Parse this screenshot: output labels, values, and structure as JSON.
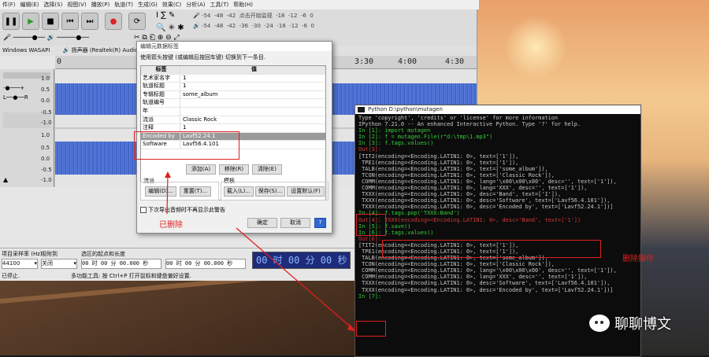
{
  "audacity": {
    "menu": [
      "件(F)",
      "编辑(E)",
      "选择(S)",
      "视图(V)",
      "播放(P)",
      "轨道(T)",
      "生成(G)",
      "效果(C)",
      "分析(A)",
      "工具(T)",
      "帮助(H)"
    ],
    "meter_hint": "点击开始监视",
    "meter_ticks_top": [
      "-54",
      "-48",
      "-42",
      "-18",
      "-12",
      "-6",
      "0"
    ],
    "meter_ticks_bottom": [
      "-54",
      "-48",
      "-42",
      "-36",
      "-30",
      "-24",
      "-18",
      "-12",
      "-6",
      "0"
    ],
    "host": "Windows WASAPI",
    "output_device": "扬声器 (Realtek(R) Audio) (loopb",
    "ruler_ticks": [
      "0",
      "3:30",
      "4:00",
      "4:30"
    ],
    "axis_labels": [
      "1.0",
      "0.5",
      "0.0",
      "-0.5",
      "-1.0",
      "1.0",
      "0.5",
      "0.0",
      "-0.5",
      "-1.0"
    ],
    "project_rate_label": "项目采样率 (Hz)",
    "snap_label": "吸附到",
    "selection_label": "选区的起点和长度",
    "project_rate": "44100",
    "snap_value": "关闭",
    "sel_start": "00 时 00 分 00.000 秒",
    "sel_length": "00 时 00 分 00.000 秒",
    "time_display": "00 时 00 分 00 秒",
    "status_left": "已停止.",
    "status_right": "多功能工具: 按 Ctrl+P 打开鼠标和键盘偏好设置."
  },
  "dialog": {
    "title": "编辑元数据标签",
    "description": "使用箭头按键 (或编辑后按回车键) 切换到下一条目.",
    "col_tag": "标签",
    "col_value": "值",
    "rows": [
      {
        "tag": "艺术家名字",
        "value": "1"
      },
      {
        "tag": "轨道标题",
        "value": "1"
      },
      {
        "tag": "专辑标题",
        "value": "some_album"
      },
      {
        "tag": "轨道编号",
        "value": ""
      },
      {
        "tag": "年",
        "value": ""
      },
      {
        "tag": "流派",
        "value": "Classic Rock"
      },
      {
        "tag": "注释",
        "value": "1"
      },
      {
        "tag": "Encoded by",
        "value": "Lavf52.24.1"
      },
      {
        "tag": "Software",
        "value": "Lavf56.4.101"
      }
    ],
    "add": "添加(A)",
    "remove": "移除(R)",
    "clear": "清除(E)",
    "genre_group": "流派",
    "edit": "编辑(D)...",
    "reset": "重置(T)...",
    "template_group": "模板",
    "load": "载入(L)...",
    "save": "保存(S)...",
    "set_default": "设置默认(F)",
    "dont_show": "下次导出音频时不再显示此警告",
    "ok": "确定",
    "cancel": "取消",
    "help": "?"
  },
  "annotations": {
    "deleted": "已删除",
    "delete_op": "删除操作"
  },
  "console": {
    "title": "Python D:\\python\\mutagen",
    "lines": [
      "Type 'copyright', 'credits' or 'license' for more information",
      "IPython 7.21.0 -- An enhanced Interactive Python. Type '?' for help.",
      "",
      "In [1]: import mutagen",
      "",
      "In [2]: f = mutagen.File(r\"d:\\tmp\\1.mp3\")",
      "",
      "In [3]: f.tags.values()",
      "Out[3]:",
      "[TIT2(encoding=<Encoding.LATIN1: 0>, text=['1']),",
      " TPE1(encoding=<Encoding.LATIN1: 0>, text=['1']),",
      " TALB(encoding=<Encoding.LATIN1: 0>, text=['some_album']),",
      " TCON(encoding=<Encoding.LATIN1: 0>, text=['Classic Rock']),",
      " COMM(encoding=<Encoding.LATIN1: 0>, lang='\\x00\\x00\\x00', desc='', text=['1']),",
      " COMM(encoding=<Encoding.LATIN1: 0>, lang='XXX', desc='', text=['1']),",
      " TXXX(encoding=<Encoding.LATIN1: 0>, desc='Band', text=['1']),",
      " TXXX(encoding=<Encoding.LATIN1: 0>, desc='Software', text=['Lavf56.4.101']),",
      " TXXX(encoding=<Encoding.LATIN1: 0>, desc='Encoded by', text=['Lavf52.24.1'])]",
      "",
      "In [4]: f.tags.pop('TXXX:Band')",
      "Out[4]: TXXX(encoding=<Encoding.LATIN1: 0>, desc='Band', text=['1'])",
      "",
      "In [5]: f.save()",
      "",
      "In [6]: f.tags.values()",
      "Out[6]:",
      "[TIT2(encoding=<Encoding.LATIN1: 0>, text=['1']),",
      " TPE1(encoding=<Encoding.LATIN1: 0>, text=['1']),",
      " TALB(encoding=<Encoding.LATIN1: 0>, text=['some_album']),",
      " TCON(encoding=<Encoding.LATIN1: 0>, text=['Classic Rock']),",
      " COMM(encoding=<Encoding.LATIN1: 0>, lang='\\x00\\x00\\x00', desc='', text=['1']),",
      " COMM(encoding=<Encoding.LATIN1: 0>, lang='XXX', desc='', text=['1']),",
      " TXXX(encoding=<Encoding.LATIN1: 0>, desc='Software', text=['Lavf56.4.101']),",
      " TXXX(encoding=<Encoding.LATIN1: 0>, desc='Encoded by', text=['Lavf52.24.1'])]",
      "",
      "In [7]:"
    ]
  },
  "watermark": "聊聊博文",
  "colors": {
    "annotation_red": "#e02020",
    "console_prompt_green": "#35d03a",
    "console_out_red": "#d43a3a"
  }
}
